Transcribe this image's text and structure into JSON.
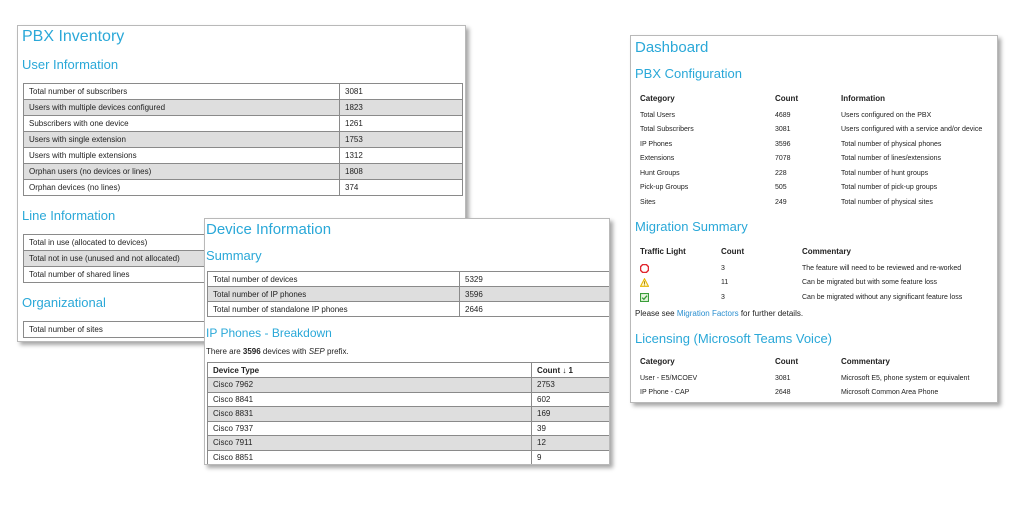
{
  "colors": {
    "accent": "#2aa8d8",
    "link": "#2a8fd0",
    "red": "#e0262e",
    "yellow": "#e6b800",
    "green": "#3a9e3a"
  },
  "inventory": {
    "title": "PBX Inventory",
    "user_heading": "User Information",
    "user_rows": [
      {
        "label": "Total number of subscribers",
        "value": "3081"
      },
      {
        "label": "Users with multiple devices configured",
        "value": "1823"
      },
      {
        "label": "Subscribers with one device",
        "value": "1261"
      },
      {
        "label": "Users with single extension",
        "value": "1753"
      },
      {
        "label": "Users with multiple extensions",
        "value": "1312"
      },
      {
        "label": "Orphan users (no devices or lines)",
        "value": "1808"
      },
      {
        "label": "Orphan devices (no lines)",
        "value": "374"
      }
    ],
    "line_heading": "Line Information",
    "line_rows": [
      {
        "label": "Total in use (allocated to devices)"
      },
      {
        "label": "Total not in use (unused and not allocated)"
      },
      {
        "label": "Total number of shared lines"
      }
    ],
    "org_heading": "Organizational",
    "org_rows": [
      {
        "label": "Total number of sites"
      }
    ]
  },
  "device": {
    "title": "Device Information",
    "summary_heading": "Summary",
    "summary_rows": [
      {
        "label": "Total number of devices",
        "value": "5329"
      },
      {
        "label": "Total number of IP phones",
        "value": "3596"
      },
      {
        "label": "Total number of standalone IP phones",
        "value": "2646"
      }
    ],
    "breakdown_heading": "IP Phones - Breakdown",
    "note_pre": "There are ",
    "note_count": "3596",
    "note_mid": " devices with ",
    "note_prefix": "SEP",
    "note_post": " prefix.",
    "col_type": "Device Type",
    "col_count": "Count ↓ 1",
    "rows": [
      {
        "type": "Cisco 7962",
        "count": "2753"
      },
      {
        "type": "Cisco 8841",
        "count": "602"
      },
      {
        "type": "Cisco 8831",
        "count": "169"
      },
      {
        "type": "Cisco 7937",
        "count": "39"
      },
      {
        "type": "Cisco 7911",
        "count": "12"
      },
      {
        "type": "Cisco 8851",
        "count": "9"
      }
    ]
  },
  "dashboard": {
    "title": "Dashboard",
    "pbx_heading": "PBX Configuration",
    "pbx_cols": [
      "Category",
      "Count",
      "Information"
    ],
    "pbx_rows": [
      {
        "category": "Total Users",
        "count": "4689",
        "info": "Users configured on the PBX"
      },
      {
        "category": "Total Subscribers",
        "count": "3081",
        "info": "Users configured with a service and/or device"
      },
      {
        "category": "IP Phones",
        "count": "3596",
        "info": "Total number of physical phones"
      },
      {
        "category": "Extensions",
        "count": "7078",
        "info": "Total number of lines/extensions"
      },
      {
        "category": "Hunt Groups",
        "count": "228",
        "info": "Total number of hunt groups"
      },
      {
        "category": "Pick-up Groups",
        "count": "505",
        "info": "Total number of pick-up groups"
      },
      {
        "category": "Sites",
        "count": "249",
        "info": "Total number of physical sites"
      }
    ],
    "migration_heading": "Migration Summary",
    "migration_cols": [
      "Traffic Light",
      "Count",
      "Commentary"
    ],
    "migration_rows": [
      {
        "icon": "red-octagon-icon",
        "count": "3",
        "comment": "The feature will need to be reviewed and re-worked"
      },
      {
        "icon": "yellow-warning-icon",
        "count": "11",
        "comment": "Can be migrated but with some feature loss"
      },
      {
        "icon": "green-check-icon",
        "count": "3",
        "comment": "Can be migrated without any significant feature loss"
      }
    ],
    "see_pre": "Please see ",
    "see_link": "Migration Factors",
    "see_post": " for further details.",
    "licensing_heading": "Licensing (Microsoft Teams Voice)",
    "lic_cols": [
      "Category",
      "Count",
      "Commentary"
    ],
    "lic_rows": [
      {
        "category": "User - E5/MCOEV",
        "count": "3081",
        "comment": "Microsoft E5, phone system or equivalent"
      },
      {
        "category": "IP Phone - CAP",
        "count": "2648",
        "comment": "Microsoft Common Area Phone"
      }
    ]
  }
}
